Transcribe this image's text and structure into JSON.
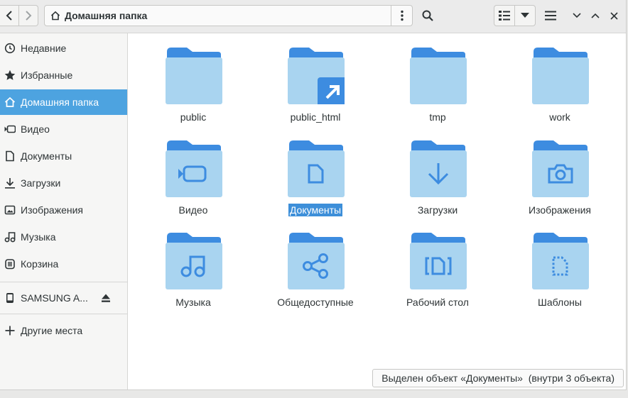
{
  "header": {
    "back_icon": "chevron-left-icon",
    "forward_icon": "chevron-right-icon",
    "path": {
      "label": "Домашняя папка",
      "icon": "home-icon"
    },
    "path_menu_icon": "vertical-dots-icon",
    "search_icon": "search-icon",
    "view_icon": "list-view-icon",
    "view_dropdown_icon": "triangle-down-icon",
    "menu_icon": "hamburger-menu-icon",
    "minimize_icon": "chevron-down-icon",
    "maximize_icon": "chevron-up-icon",
    "close_icon": "close-icon"
  },
  "sidebar": {
    "items": [
      {
        "label": "Недавние",
        "icon": "clock-icon"
      },
      {
        "label": "Избранные",
        "icon": "star-icon"
      },
      {
        "label": "Домашняя папка",
        "icon": "home-icon",
        "active": true
      },
      {
        "label": "Видео",
        "icon": "video-icon"
      },
      {
        "label": "Документы",
        "icon": "document-icon"
      },
      {
        "label": "Загрузки",
        "icon": "download-icon"
      },
      {
        "label": "Изображения",
        "icon": "image-icon"
      },
      {
        "label": "Музыка",
        "icon": "music-icon"
      },
      {
        "label": "Корзина",
        "icon": "trash-icon"
      }
    ],
    "device": {
      "label": "SAMSUNG A...",
      "icon": "phone-icon",
      "eject_icon": "eject-icon"
    },
    "other": {
      "label": "Другие места",
      "icon": "plus-icon"
    }
  },
  "folders": [
    {
      "name": "public",
      "emblem": "none"
    },
    {
      "name": "public_html",
      "emblem": "link-arrow-icon"
    },
    {
      "name": "tmp",
      "emblem": "none"
    },
    {
      "name": "work",
      "emblem": "none"
    },
    {
      "name": "Видео",
      "emblem": "video-icon"
    },
    {
      "name": "Документы",
      "emblem": "document-icon",
      "selected": true
    },
    {
      "name": "Загрузки",
      "emblem": "download-icon"
    },
    {
      "name": "Изображения",
      "emblem": "camera-icon"
    },
    {
      "name": "Музыка",
      "emblem": "music-icon"
    },
    {
      "name": "Общедоступные",
      "emblem": "share-icon"
    },
    {
      "name": "Рабочий стол",
      "emblem": "desktop-icon"
    },
    {
      "name": "Шаблоны",
      "emblem": "template-icon"
    }
  ],
  "status": "Выделен объект «Документы»  (внутри 3 объекта)",
  "colors": {
    "accent": "#4da3e0",
    "selection": "#3d8fd9",
    "folder_back": "#3d8ce0",
    "folder_front": "#a9d4f0",
    "emblem": "#3d8ce0"
  }
}
